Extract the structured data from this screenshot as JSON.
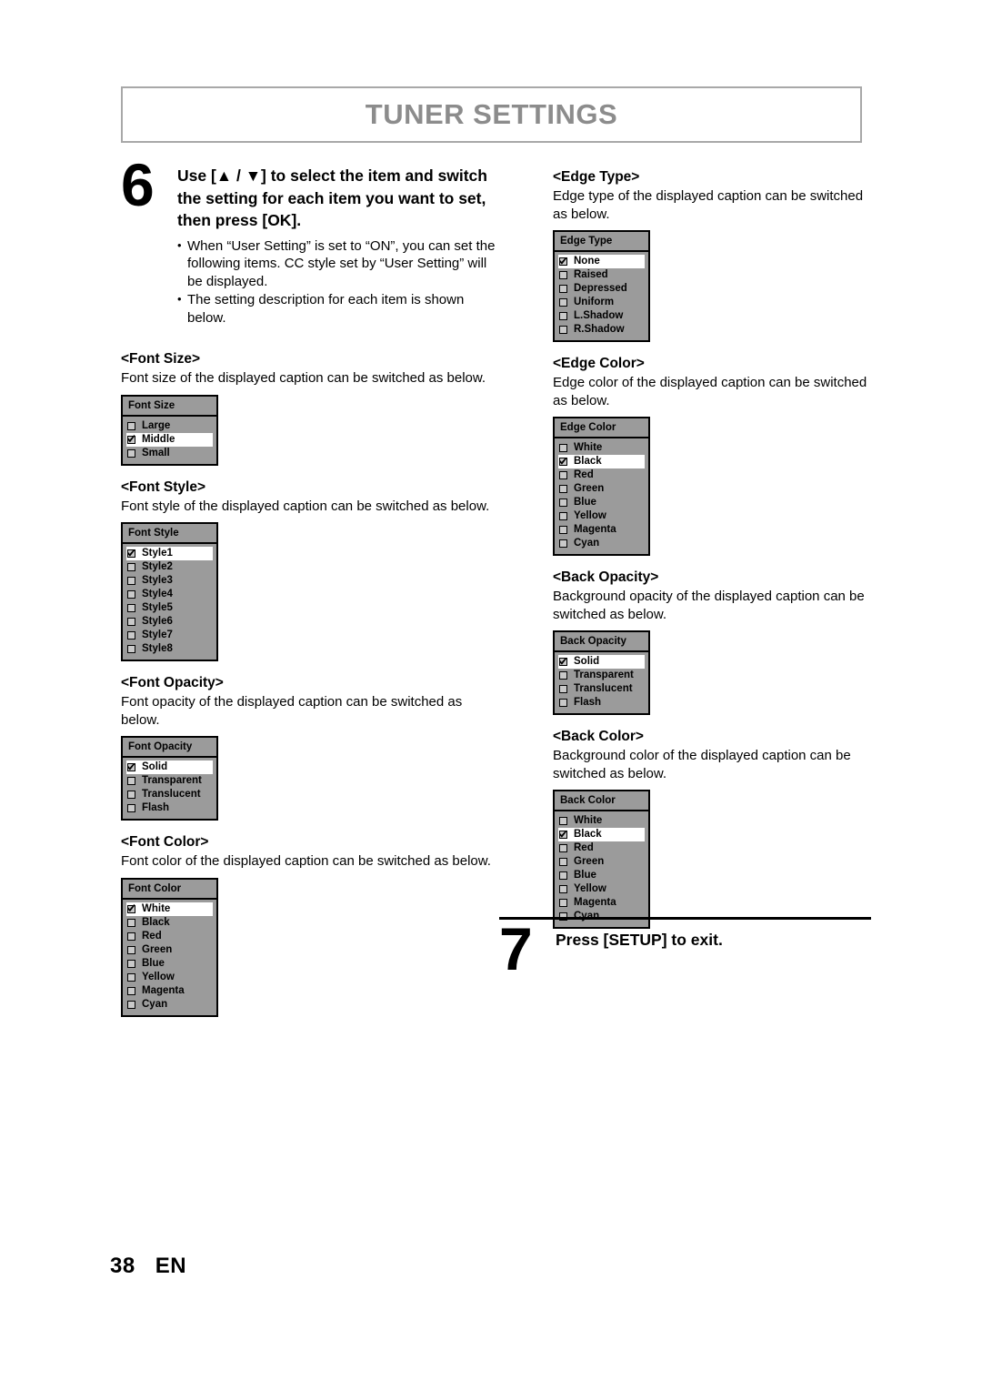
{
  "header": {
    "title": "TUNER SETTINGS"
  },
  "step6": {
    "number": "6",
    "title": "Use [▲ / ▼] to select the item and switch the setting for each item you want to set, then press [OK].",
    "bullets": [
      "When “User Setting” is set to “ON”, you can set the following items. CC style set by “User Setting” will be displayed.",
      "The setting description for each item is shown below."
    ]
  },
  "step7": {
    "number": "7",
    "title": "Press [SETUP] to exit."
  },
  "sections": {
    "font_size": {
      "heading": "<Font Size>",
      "description": "Font size of the displayed caption can be switched as below.",
      "menu": {
        "title": "Font Size",
        "options": [
          {
            "label": "Large",
            "selected": false
          },
          {
            "label": "Middle",
            "selected": true
          },
          {
            "label": "Small",
            "selected": false
          }
        ]
      }
    },
    "font_style": {
      "heading": "<Font Style>",
      "description": "Font style of the displayed caption can be switched as below.",
      "menu": {
        "title": "Font Style",
        "options": [
          {
            "label": "Style1",
            "selected": true
          },
          {
            "label": "Style2",
            "selected": false
          },
          {
            "label": "Style3",
            "selected": false
          },
          {
            "label": "Style4",
            "selected": false
          },
          {
            "label": "Style5",
            "selected": false
          },
          {
            "label": "Style6",
            "selected": false
          },
          {
            "label": "Style7",
            "selected": false
          },
          {
            "label": "Style8",
            "selected": false
          }
        ]
      }
    },
    "font_opacity": {
      "heading": "<Font Opacity>",
      "description": "Font opacity of the displayed caption can be switched as below.",
      "menu": {
        "title": "Font Opacity",
        "options": [
          {
            "label": "Solid",
            "selected": true
          },
          {
            "label": "Transparent",
            "selected": false
          },
          {
            "label": "Translucent",
            "selected": false
          },
          {
            "label": "Flash",
            "selected": false
          }
        ]
      }
    },
    "font_color": {
      "heading": "<Font Color>",
      "description": "Font color of the displayed caption can be switched as below.",
      "menu": {
        "title": "Font Color",
        "options": [
          {
            "label": "White",
            "selected": true
          },
          {
            "label": "Black",
            "selected": false
          },
          {
            "label": "Red",
            "selected": false
          },
          {
            "label": "Green",
            "selected": false
          },
          {
            "label": "Blue",
            "selected": false
          },
          {
            "label": "Yellow",
            "selected": false
          },
          {
            "label": "Magenta",
            "selected": false
          },
          {
            "label": "Cyan",
            "selected": false
          }
        ]
      }
    },
    "edge_type": {
      "heading": "<Edge Type>",
      "description": "Edge type of the displayed caption can be switched as below.",
      "menu": {
        "title": "Edge Type",
        "options": [
          {
            "label": "None",
            "selected": true
          },
          {
            "label": "Raised",
            "selected": false
          },
          {
            "label": "Depressed",
            "selected": false
          },
          {
            "label": "Uniform",
            "selected": false
          },
          {
            "label": "L.Shadow",
            "selected": false
          },
          {
            "label": "R.Shadow",
            "selected": false
          }
        ]
      }
    },
    "edge_color": {
      "heading": "<Edge Color>",
      "description": "Edge color of the displayed caption can be switched as below.",
      "menu": {
        "title": "Edge Color",
        "options": [
          {
            "label": "White",
            "selected": false
          },
          {
            "label": "Black",
            "selected": true
          },
          {
            "label": "Red",
            "selected": false
          },
          {
            "label": "Green",
            "selected": false
          },
          {
            "label": "Blue",
            "selected": false
          },
          {
            "label": "Yellow",
            "selected": false
          },
          {
            "label": "Magenta",
            "selected": false
          },
          {
            "label": "Cyan",
            "selected": false
          }
        ]
      }
    },
    "back_opacity": {
      "heading": "<Back Opacity>",
      "description": "Background opacity of the displayed caption can be switched as below.",
      "menu": {
        "title": "Back Opacity",
        "options": [
          {
            "label": "Solid",
            "selected": true
          },
          {
            "label": "Transparent",
            "selected": false
          },
          {
            "label": "Translucent",
            "selected": false
          },
          {
            "label": "Flash",
            "selected": false
          }
        ]
      }
    },
    "back_color": {
      "heading": "<Back Color>",
      "description": "Background color of the displayed caption can be switched as below.",
      "menu": {
        "title": "Back Color",
        "options": [
          {
            "label": "White",
            "selected": false
          },
          {
            "label": "Black",
            "selected": true
          },
          {
            "label": "Red",
            "selected": false
          },
          {
            "label": "Green",
            "selected": false
          },
          {
            "label": "Blue",
            "selected": false
          },
          {
            "label": "Yellow",
            "selected": false
          },
          {
            "label": "Magenta",
            "selected": false
          },
          {
            "label": "Cyan",
            "selected": false
          }
        ]
      }
    }
  },
  "footer": {
    "page_number": "38",
    "language": "EN"
  },
  "colors": {
    "header_title": "#8c8c8c",
    "header_border": "#a8a8a8",
    "osd_background": "#9b9b9b",
    "osd_selected_row": "#ffffff",
    "text": "#000000"
  }
}
